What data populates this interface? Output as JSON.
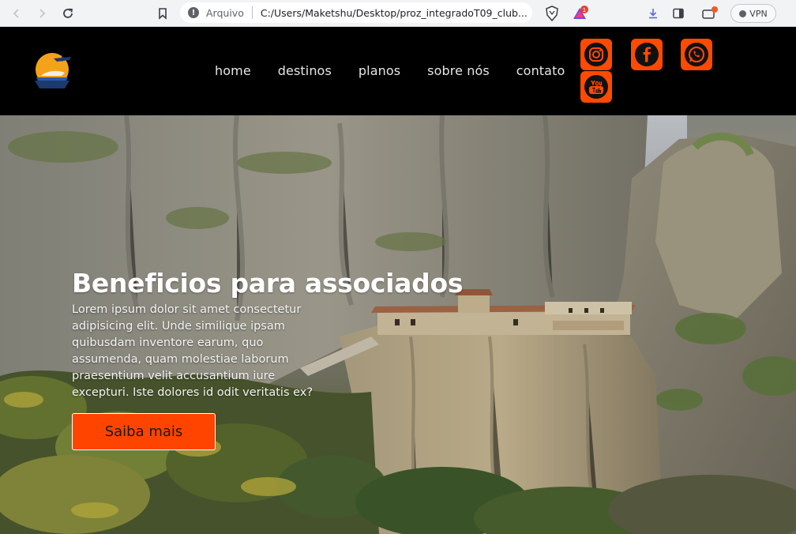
{
  "browser": {
    "address_label": "Arquivo",
    "url": "C:/Users/Maketshu/Desktop/proz_integradoT09_club...",
    "vpn_label": "VPN",
    "brave_rewards_badge": "1",
    "icons": [
      "back-icon",
      "forward-icon",
      "reload-icon",
      "bookmark-icon",
      "brave-shield-icon",
      "brave-rewards-icon",
      "download-icon",
      "sidebar-icon",
      "wallet-icon"
    ]
  },
  "site": {
    "nav": [
      {
        "label": "home"
      },
      {
        "label": "destinos"
      },
      {
        "label": "planos"
      },
      {
        "label": "sobre nós"
      },
      {
        "label": "contato"
      }
    ],
    "social": [
      "instagram",
      "facebook",
      "whatsapp",
      "youtube"
    ],
    "accent_color": "#ff4a00"
  },
  "hero": {
    "title": "Beneficios para associados",
    "text": "Lorem ipsum dolor sit amet consectetur adipisicing elit. Unde similique ipsam quibusdam inventore earum, quo assumenda, quam molestiae laborum praesentium velit accusantium iure excepturi. Iste dolores id odit veritatis ex?",
    "cta_label": "Saiba mais"
  }
}
